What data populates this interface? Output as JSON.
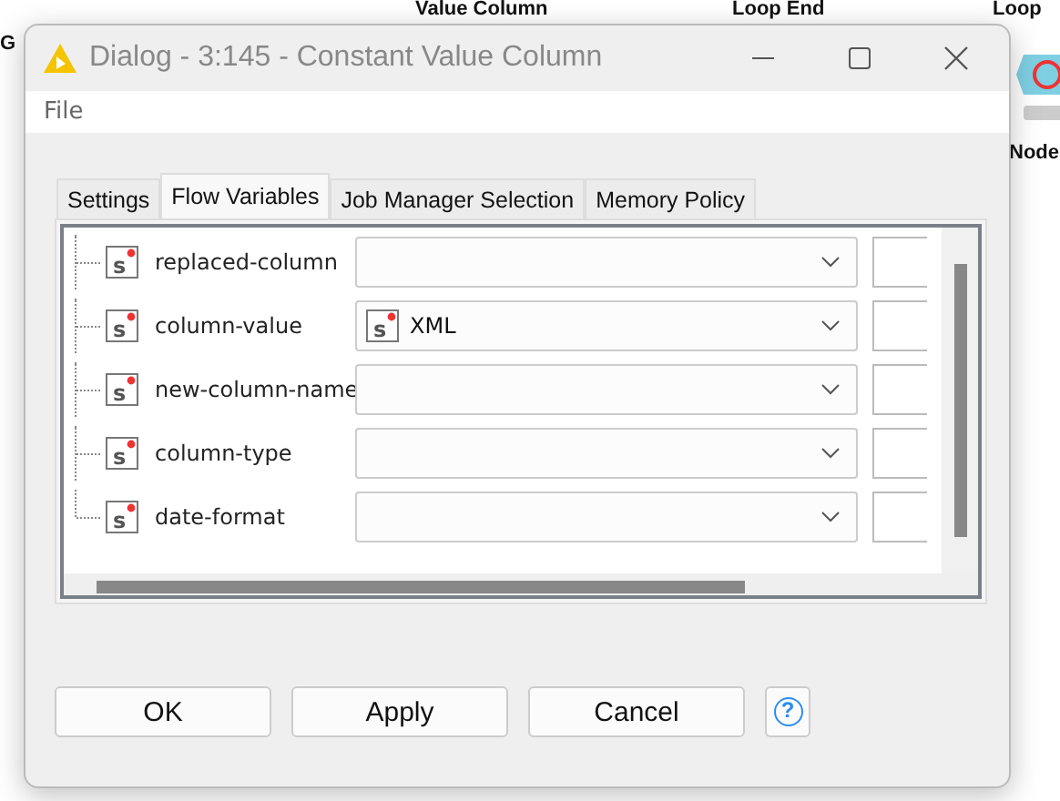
{
  "canvas": {
    "node_labels": [
      {
        "text": "G"
      },
      {
        "text": "Value Column"
      },
      {
        "text": "Loop End"
      },
      {
        "text": "Loop"
      },
      {
        "text": "Node"
      }
    ]
  },
  "window": {
    "title": "Dialog - 3:145 - Constant Value Column"
  },
  "menu": [
    "File"
  ],
  "tabs": [
    {
      "label": "Settings",
      "selected": false
    },
    {
      "label": "Flow Variables",
      "selected": true
    },
    {
      "label": "Job Manager Selection",
      "selected": false
    },
    {
      "label": "Memory Policy",
      "selected": false
    }
  ],
  "variables": [
    {
      "name": "replaced-column",
      "type_letter": "s"
    },
    {
      "name": "column-value",
      "type_letter": "s",
      "value": "XML",
      "value_type_letter": "s"
    },
    {
      "name": "new-column-name",
      "type_letter": "s"
    },
    {
      "name": "column-type",
      "type_letter": "s"
    },
    {
      "name": "date-format",
      "type_letter": "s"
    }
  ],
  "buttons": [
    "OK",
    "Apply",
    "Cancel"
  ],
  "help_button": {
    "label": "?"
  }
}
